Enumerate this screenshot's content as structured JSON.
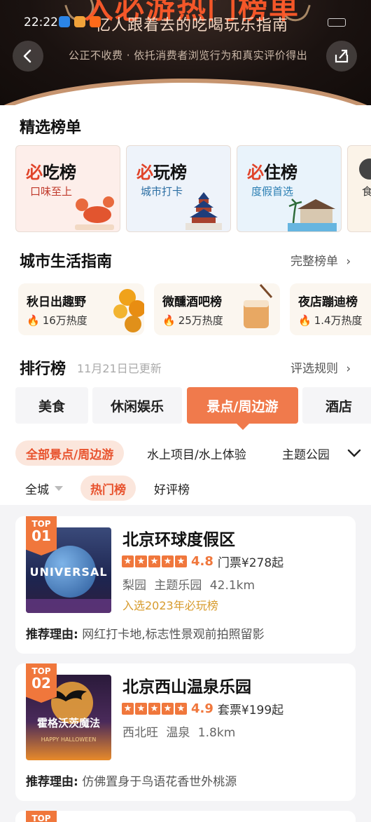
{
  "status": {
    "time": "22:22"
  },
  "header": {
    "big_title": "入必游热门榜单",
    "subtitle": "亿人跟着去的吃喝玩乐指南",
    "tagline": "公正不收费 · 依托消费者浏览行为和真实评价得出"
  },
  "featured": {
    "title": "精选榜单",
    "cards": [
      {
        "mark": "必",
        "name": "吃榜",
        "sub": "口味至上",
        "sub_color": "#c0392b",
        "bg": "#fdeeea",
        "icon": "lobster-icon"
      },
      {
        "mark": "必",
        "name": "玩榜",
        "sub": "城市打卡",
        "sub_color": "#2b6ea3",
        "bg": "#eef3fa",
        "icon": "temple-of-heaven-icon"
      },
      {
        "mark": "必",
        "name": "住榜",
        "sub": "度假首选",
        "sub_color": "#2b7fb3",
        "bg": "#e9f3fb",
        "icon": "resort-icon"
      },
      {
        "mark": "",
        "name": "",
        "sub": "食",
        "sub_color": "#333",
        "bg": "#fbf3e8",
        "icon": "food-icon"
      }
    ]
  },
  "city_guide": {
    "title": "城市生活指南",
    "link": "完整榜单",
    "items": [
      {
        "name": "秋日出趣野",
        "heat": "16万热度",
        "icon": "osmanthus-icon"
      },
      {
        "name": "微醺酒吧榜",
        "heat": "25万热度",
        "icon": "cocktail-icon"
      },
      {
        "name": "夜店蹦迪榜",
        "heat": "1.4万热度",
        "icon": "disco-icon"
      }
    ]
  },
  "ranking": {
    "title": "排行榜",
    "updated": "11月21日已更新",
    "rules_link": "评选规则",
    "tabs": [
      "美食",
      "休闲娱乐",
      "景点/周边游",
      "酒店"
    ],
    "active_tab": 2,
    "subcats": [
      "全部景点/周边游",
      "水上项目/水上体验",
      "主题公园"
    ],
    "filters": {
      "city": "全城",
      "hot": "热门榜",
      "good": "好评榜"
    }
  },
  "list": [
    {
      "badge_top": "TOP",
      "badge_num": "01",
      "name": "北京环球度假区",
      "score": "4.8",
      "price": "门票¥278起",
      "meta": "梨园 主题乐园 42.1km",
      "award": "入选2023年必玩榜",
      "reason_label": "推荐理由:",
      "reason": "网红打卡地,标志性景观前拍照留影",
      "thumb_text": "UNIVERSAL"
    },
    {
      "badge_top": "TOP",
      "badge_num": "02",
      "name": "北京西山温泉乐园",
      "score": "4.9",
      "price": "套票¥199起",
      "meta": "西北旺 温泉 1.8km",
      "award": "",
      "reason_label": "推荐理由:",
      "reason": "仿佛置身于鸟语花香世外桃源",
      "thumb_text": "霍格沃茨魔法",
      "thumb_sub": "HAPPY HALLOWEEN"
    },
    {
      "badge_top": "TOP"
    }
  ],
  "colors": {
    "accent": "#f0773c",
    "brand_red": "#e8532e"
  }
}
